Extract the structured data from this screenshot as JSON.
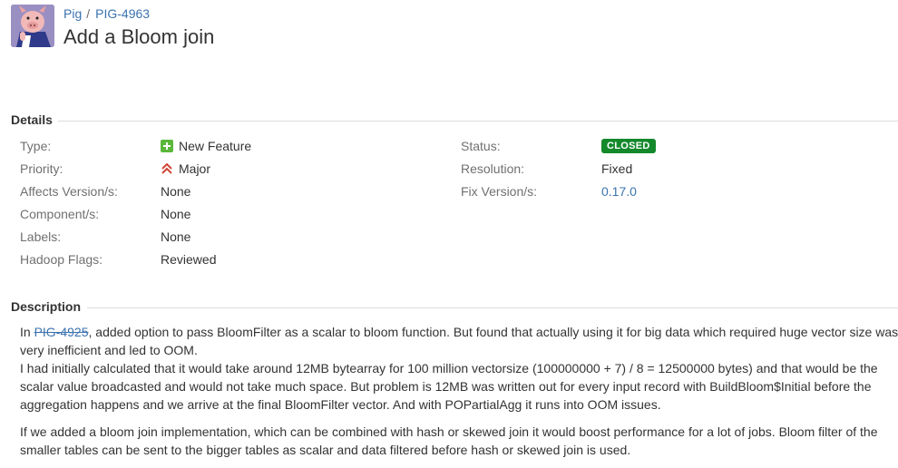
{
  "header": {
    "project": "Pig",
    "separator": "/",
    "issue_key": "PIG-4963",
    "title": "Add a Bloom join"
  },
  "details": {
    "heading": "Details",
    "left_fields": [
      {
        "label": "Type:",
        "value": "New Feature",
        "icon": "new-feature-icon"
      },
      {
        "label": "Priority:",
        "value": "Major",
        "icon": "major-priority-icon"
      },
      {
        "label": "Affects Version/s:",
        "value": "None"
      },
      {
        "label": "Component/s:",
        "value": "None"
      },
      {
        "label": "Labels:",
        "value": "None"
      },
      {
        "label": "Hadoop Flags:",
        "value": "Reviewed"
      }
    ],
    "right_fields": [
      {
        "label": "Status:",
        "value": "CLOSED"
      },
      {
        "label": "Resolution:",
        "value": "Fixed"
      },
      {
        "label": "Fix Version/s:",
        "value": "0.17.0"
      }
    ]
  },
  "description": {
    "heading": "Description",
    "p1_prefix": "In ",
    "p1_link": "PIG-4925",
    "p1_rest": ", added option to pass BloomFilter as a scalar to bloom function. But found that actually using it for big data which required huge vector size was very inefficient and led to OOM.",
    "p1_line2": "I had initially calculated that it would take around 12MB bytearray for 100 million vectorsize (100000000 + 7) / 8 = 12500000 bytes) and that would be the scalar value broadcasted and would not take much space. But problem is 12MB was written out for every input record with BuildBloom$Initial before the aggregation happens and we arrive at the final BloomFilter vector. And with POPartialAgg it runs into OOM issues.",
    "p2": "If we added a bloom join implementation, which can be combined with hash or skewed join it would boost performance for a lot of jobs. Bloom filter of the smaller tables can be sent to the bigger tables as scalar and data filtered before hash or skewed join is used."
  },
  "colors": {
    "link": "#3b73af",
    "status_closed": "#14892c",
    "new_feature": "#5bb73b",
    "priority_major": "#d04437"
  }
}
